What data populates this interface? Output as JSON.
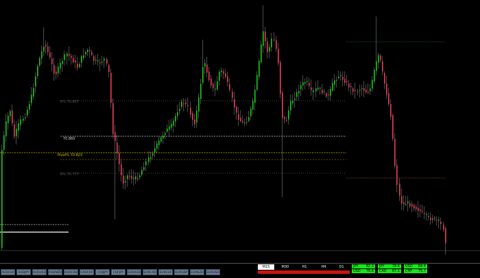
{
  "chart": {
    "colors": {
      "background": "#000000",
      "bull": "#18c418",
      "bear": "#e03a55",
      "wick": "#9a9a9a"
    },
    "levels": [
      {
        "label": "6% 70.887",
        "color": "#5a5a5a",
        "style": "dotted"
      },
      {
        "label": "70.860",
        "color": "#d8d8d8",
        "style": "dashed"
      },
      {
        "label": "Pivot% 70.823",
        "color": "#d6c200",
        "style": "dashed"
      },
      {
        "label": "6% 70.777",
        "color": "#5a5a5a",
        "style": "dotted"
      }
    ],
    "extra_lines": [
      {
        "name": "green-dotted-level",
        "color": "#2e7d2e"
      },
      {
        "name": "orange-dotted-level",
        "color": "#c0602a"
      },
      {
        "name": "white-dashed-left-level",
        "color": "#cfcfcf"
      },
      {
        "name": "white-solid-left-level",
        "color": "#ffffff"
      },
      {
        "name": "grey-bottom-line",
        "color": "#6a6a6a"
      }
    ]
  },
  "symbol_tabs": [
    "AUDCHF",
    "AUDJPY",
    "AUDUSD",
    "AUDNZD",
    "AUDCAD",
    "CADCHF",
    "CADJPY",
    "CHFJPY",
    "EURAUD",
    "EURCAD",
    "EURCHF",
    "EURGBP",
    "EURNZD",
    "EURUSD"
  ],
  "timeframes": {
    "items": [
      "M15",
      "M30",
      "H1",
      "H4",
      "D1"
    ],
    "active": "M15"
  },
  "currency_strength": [
    {
      "currency": "JPY",
      "value": "82.3"
    },
    {
      "currency": "JPY",
      "value": "78.6"
    },
    {
      "currency": "USD",
      "value": "84.4"
    },
    {
      "currency": "USD",
      "value": "78.6"
    },
    {
      "currency": "CAD",
      "value": "67.1"
    },
    {
      "currency": "CHF",
      "value": "75.7"
    }
  ]
}
